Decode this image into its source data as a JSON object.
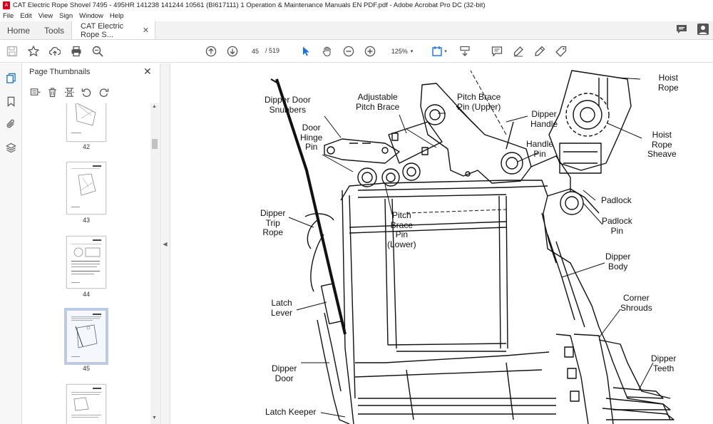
{
  "window": {
    "title": "CAT Electric Rope Shovel 7495 - 495HR 141238 141244 10561 (BI617111) 1 Operation & Maintenance Manuals EN PDF.pdf - Adobe Acrobat Pro DC (32-bit)"
  },
  "menu": [
    "File",
    "Edit",
    "View",
    "Sign",
    "Window",
    "Help"
  ],
  "tabs": {
    "home": "Home",
    "tools": "Tools",
    "document": "CAT Electric Rope S..."
  },
  "toolbar": {
    "current_page": "45",
    "page_total": "/ 519",
    "zoom": "125%"
  },
  "panel": {
    "title": "Page Thumbnails",
    "thumbnails": [
      {
        "label": "42"
      },
      {
        "label": "43"
      },
      {
        "label": "44"
      },
      {
        "label": "45",
        "selected": true
      },
      {
        "label": ""
      }
    ]
  },
  "drawing": {
    "callouts": {
      "dipper_door_snubbers": "Dipper Door\nSnubbers",
      "adjustable_pitch_brace": "Adjustable\nPitch Brace",
      "pitch_brace_pin_upper": "Pitch Brace\nPin (Upper)",
      "hoist_rope": "Hoist\nRope",
      "dipper_handle": "Dipper\nHandle",
      "door_hinge_pin": "Door\nHinge\nPin",
      "handle_pin": "Handle\nPin",
      "hoist_rope_sheave": "Hoist\nRope\nSheave",
      "dipper_trip_rope": "Dipper\nTrip\nRope",
      "pitch_brace_pin_lower": "Pitch\nBrace\nPin\n(Lower)",
      "padlock": "Padlock",
      "padlock_pin": "Padlock\nPin",
      "dipper_body": "Dipper\nBody",
      "latch_lever": "Latch\nLever",
      "corner_shrouds": "Corner\nShrouds",
      "dipper_door": "Dipper\nDoor",
      "dipper_teeth": "Dipper\nTeeth",
      "latch_keeper": "Latch Keeper"
    }
  },
  "colors": {
    "accent": "#1473e6",
    "pdf_red": "#d6001c",
    "selection": "#b9cbe6"
  }
}
